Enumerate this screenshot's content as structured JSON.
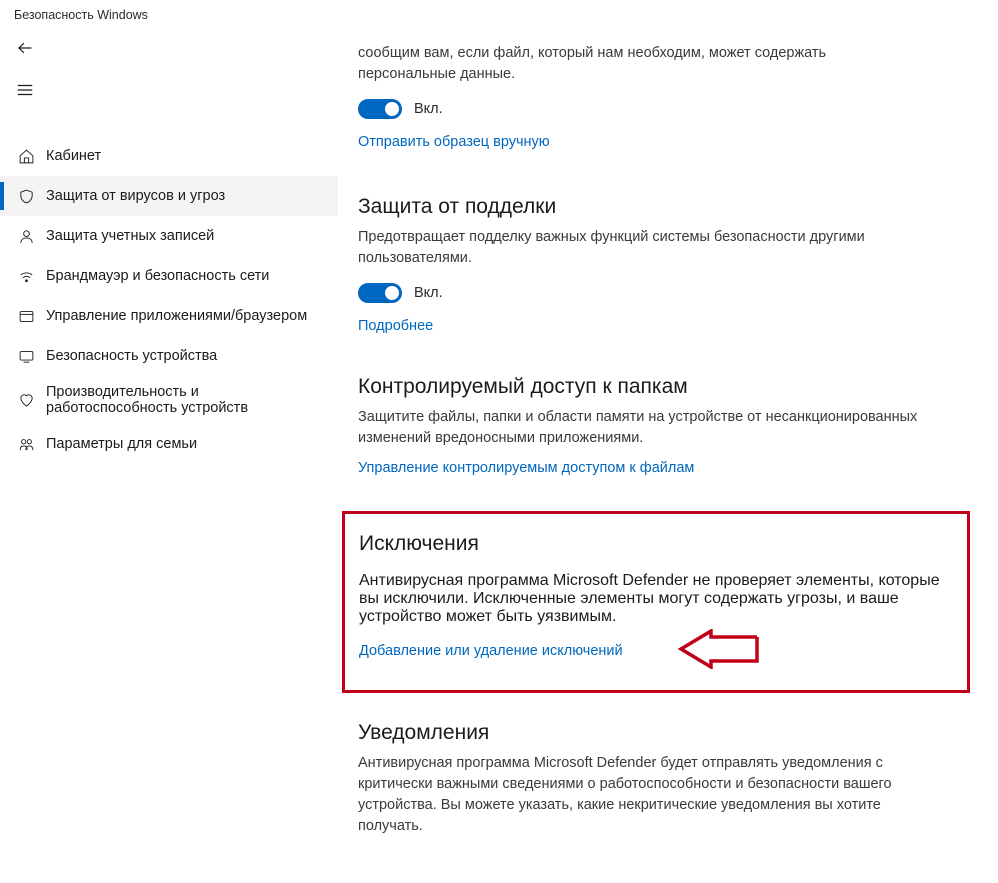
{
  "window_title": "Безопасность Windows",
  "sidebar": {
    "items": [
      {
        "label": "Кабинет",
        "icon": "home"
      },
      {
        "label": "Защита от вирусов и угроз",
        "icon": "shield",
        "active": true
      },
      {
        "label": "Защита учетных записей",
        "icon": "person"
      },
      {
        "label": "Брандмауэр и безопасность сети",
        "icon": "wifi"
      },
      {
        "label": "Управление приложениями/браузером",
        "icon": "app"
      },
      {
        "label": "Безопасность устройства",
        "icon": "device"
      },
      {
        "label": "Производительность и работоспособность устройств",
        "icon": "heart",
        "tall": true
      },
      {
        "label": "Параметры для семьи",
        "icon": "family"
      }
    ]
  },
  "sections": {
    "sample_submit": {
      "intro": "сообщим вам, если файл, который нам необходим, может содержать персональные данные.",
      "toggle_label": "Вкл.",
      "link": "Отправить образец вручную"
    },
    "tamper": {
      "title": "Защита от подделки",
      "desc": "Предотвращает подделку важных функций системы безопасности другими пользователями.",
      "toggle_label": "Вкл.",
      "link": "Подробнее"
    },
    "folder_access": {
      "title": "Контролируемый доступ к папкам",
      "desc": "Защитите файлы, папки и области памяти на устройстве от несанкционированных изменений вредоносными приложениями.",
      "link": "Управление контролируемым доступом к файлам"
    },
    "exclusions": {
      "title": "Исключения",
      "desc": "Антивирусная программа Microsoft Defender не проверяет элементы, которые вы исключили. Исключенные элементы могут содержать угрозы, и ваше устройство может быть уязвимым.",
      "link": "Добавление или удаление исключений"
    },
    "notifications": {
      "title": "Уведомления",
      "desc": "Антивирусная программа Microsoft Defender будет отправлять уведомления с критически важными сведениями о работоспособности и безопасности вашего устройства. Вы можете указать, какие некритические уведомления вы хотите получать."
    }
  }
}
